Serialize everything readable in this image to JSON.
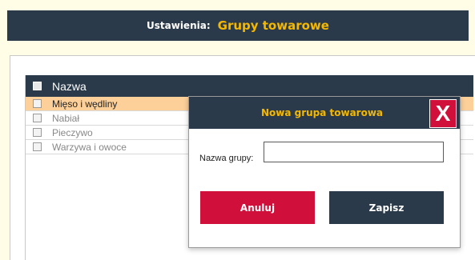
{
  "header": {
    "label": "Ustawienia:",
    "title": "Grupy towarowe"
  },
  "table": {
    "column": "Nazwa",
    "rows": [
      {
        "name": "Mięso i wędliny",
        "selected": true
      },
      {
        "name": "Nabiał",
        "selected": false
      },
      {
        "name": "Pieczywo",
        "selected": false
      },
      {
        "name": "Warzywa i owoce",
        "selected": false
      }
    ]
  },
  "modal": {
    "title": "Nowa grupa towarowa",
    "close_label": "X",
    "field_label": "Nazwa grupy:",
    "field_value": "",
    "cancel_label": "Anuluj",
    "save_label": "Zapisz"
  },
  "colors": {
    "header_bg": "#2b3a4a",
    "accent": "#f5b800",
    "danger": "#d0103a",
    "selected_row": "#fdd09a",
    "page_bg": "#fffde6"
  }
}
